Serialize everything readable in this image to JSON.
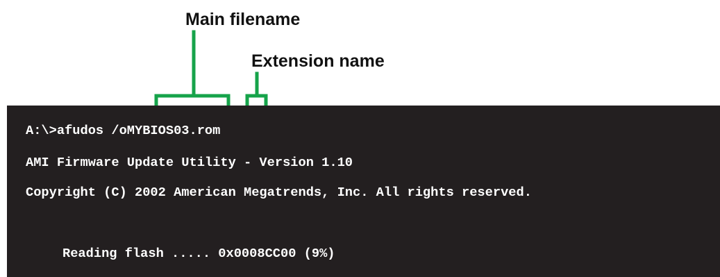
{
  "callouts": {
    "main_filename": "Main filename",
    "extension_name": "Extension name"
  },
  "terminal": {
    "lines": [
      "A:\\>afudos /oMYBIOS03.rom",
      "AMI Firmware Update Utility - Version 1.10",
      "Copyright (C) 2002 American Megatrends, Inc. All rights reserved.",
      "Reading flash ..... 0x0008CC00 (9%)"
    ]
  },
  "colors": {
    "bracket": "#16a34a",
    "terminal_bg": "#231f20",
    "terminal_text": "#ffffff"
  }
}
